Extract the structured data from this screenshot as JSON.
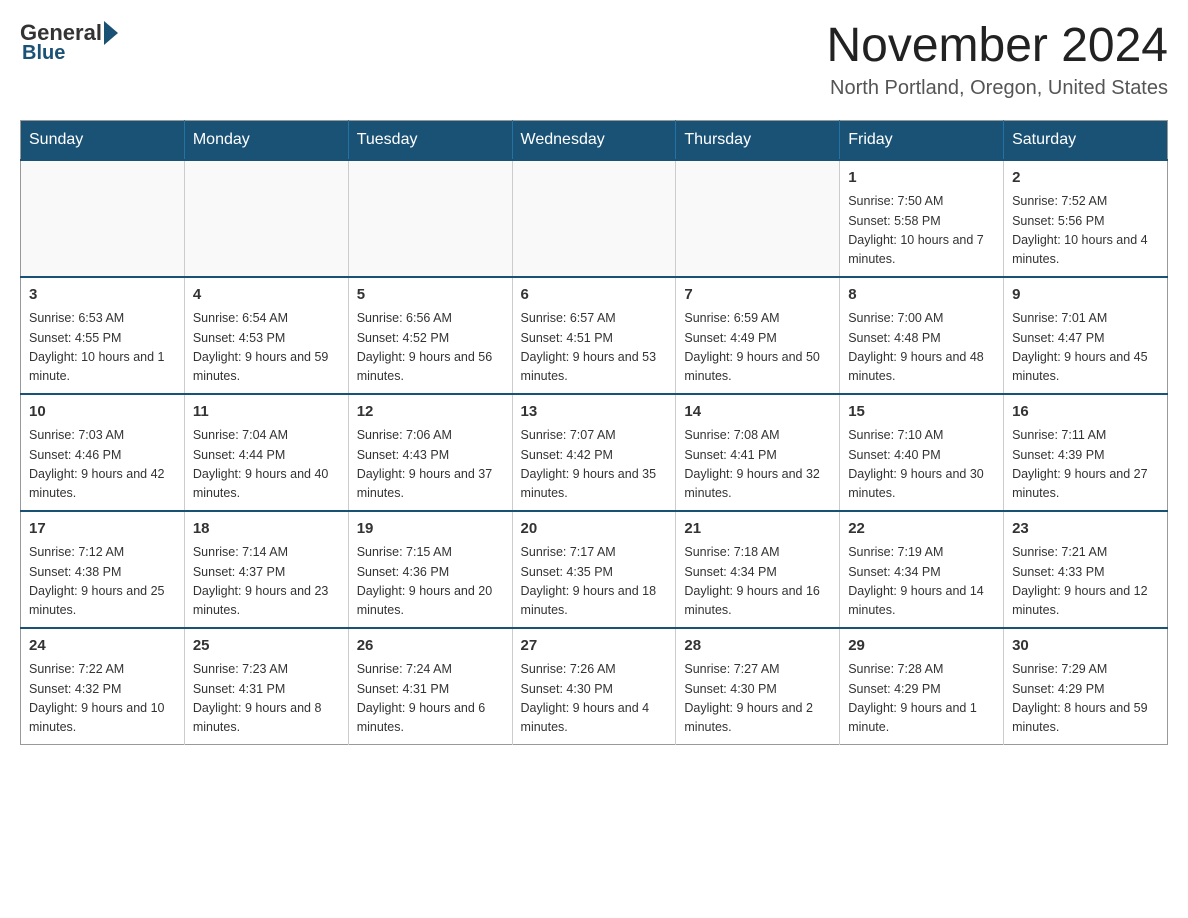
{
  "header": {
    "logo": {
      "general": "General",
      "blue": "Blue"
    },
    "title": "November 2024",
    "subtitle": "North Portland, Oregon, United States"
  },
  "weekdays": [
    "Sunday",
    "Monday",
    "Tuesday",
    "Wednesday",
    "Thursday",
    "Friday",
    "Saturday"
  ],
  "weeks": [
    [
      {
        "day": "",
        "sunrise": "",
        "sunset": "",
        "daylight": ""
      },
      {
        "day": "",
        "sunrise": "",
        "sunset": "",
        "daylight": ""
      },
      {
        "day": "",
        "sunrise": "",
        "sunset": "",
        "daylight": ""
      },
      {
        "day": "",
        "sunrise": "",
        "sunset": "",
        "daylight": ""
      },
      {
        "day": "",
        "sunrise": "",
        "sunset": "",
        "daylight": ""
      },
      {
        "day": "1",
        "sunrise": "Sunrise: 7:50 AM",
        "sunset": "Sunset: 5:58 PM",
        "daylight": "Daylight: 10 hours and 7 minutes."
      },
      {
        "day": "2",
        "sunrise": "Sunrise: 7:52 AM",
        "sunset": "Sunset: 5:56 PM",
        "daylight": "Daylight: 10 hours and 4 minutes."
      }
    ],
    [
      {
        "day": "3",
        "sunrise": "Sunrise: 6:53 AM",
        "sunset": "Sunset: 4:55 PM",
        "daylight": "Daylight: 10 hours and 1 minute."
      },
      {
        "day": "4",
        "sunrise": "Sunrise: 6:54 AM",
        "sunset": "Sunset: 4:53 PM",
        "daylight": "Daylight: 9 hours and 59 minutes."
      },
      {
        "day": "5",
        "sunrise": "Sunrise: 6:56 AM",
        "sunset": "Sunset: 4:52 PM",
        "daylight": "Daylight: 9 hours and 56 minutes."
      },
      {
        "day": "6",
        "sunrise": "Sunrise: 6:57 AM",
        "sunset": "Sunset: 4:51 PM",
        "daylight": "Daylight: 9 hours and 53 minutes."
      },
      {
        "day": "7",
        "sunrise": "Sunrise: 6:59 AM",
        "sunset": "Sunset: 4:49 PM",
        "daylight": "Daylight: 9 hours and 50 minutes."
      },
      {
        "day": "8",
        "sunrise": "Sunrise: 7:00 AM",
        "sunset": "Sunset: 4:48 PM",
        "daylight": "Daylight: 9 hours and 48 minutes."
      },
      {
        "day": "9",
        "sunrise": "Sunrise: 7:01 AM",
        "sunset": "Sunset: 4:47 PM",
        "daylight": "Daylight: 9 hours and 45 minutes."
      }
    ],
    [
      {
        "day": "10",
        "sunrise": "Sunrise: 7:03 AM",
        "sunset": "Sunset: 4:46 PM",
        "daylight": "Daylight: 9 hours and 42 minutes."
      },
      {
        "day": "11",
        "sunrise": "Sunrise: 7:04 AM",
        "sunset": "Sunset: 4:44 PM",
        "daylight": "Daylight: 9 hours and 40 minutes."
      },
      {
        "day": "12",
        "sunrise": "Sunrise: 7:06 AM",
        "sunset": "Sunset: 4:43 PM",
        "daylight": "Daylight: 9 hours and 37 minutes."
      },
      {
        "day": "13",
        "sunrise": "Sunrise: 7:07 AM",
        "sunset": "Sunset: 4:42 PM",
        "daylight": "Daylight: 9 hours and 35 minutes."
      },
      {
        "day": "14",
        "sunrise": "Sunrise: 7:08 AM",
        "sunset": "Sunset: 4:41 PM",
        "daylight": "Daylight: 9 hours and 32 minutes."
      },
      {
        "day": "15",
        "sunrise": "Sunrise: 7:10 AM",
        "sunset": "Sunset: 4:40 PM",
        "daylight": "Daylight: 9 hours and 30 minutes."
      },
      {
        "day": "16",
        "sunrise": "Sunrise: 7:11 AM",
        "sunset": "Sunset: 4:39 PM",
        "daylight": "Daylight: 9 hours and 27 minutes."
      }
    ],
    [
      {
        "day": "17",
        "sunrise": "Sunrise: 7:12 AM",
        "sunset": "Sunset: 4:38 PM",
        "daylight": "Daylight: 9 hours and 25 minutes."
      },
      {
        "day": "18",
        "sunrise": "Sunrise: 7:14 AM",
        "sunset": "Sunset: 4:37 PM",
        "daylight": "Daylight: 9 hours and 23 minutes."
      },
      {
        "day": "19",
        "sunrise": "Sunrise: 7:15 AM",
        "sunset": "Sunset: 4:36 PM",
        "daylight": "Daylight: 9 hours and 20 minutes."
      },
      {
        "day": "20",
        "sunrise": "Sunrise: 7:17 AM",
        "sunset": "Sunset: 4:35 PM",
        "daylight": "Daylight: 9 hours and 18 minutes."
      },
      {
        "day": "21",
        "sunrise": "Sunrise: 7:18 AM",
        "sunset": "Sunset: 4:34 PM",
        "daylight": "Daylight: 9 hours and 16 minutes."
      },
      {
        "day": "22",
        "sunrise": "Sunrise: 7:19 AM",
        "sunset": "Sunset: 4:34 PM",
        "daylight": "Daylight: 9 hours and 14 minutes."
      },
      {
        "day": "23",
        "sunrise": "Sunrise: 7:21 AM",
        "sunset": "Sunset: 4:33 PM",
        "daylight": "Daylight: 9 hours and 12 minutes."
      }
    ],
    [
      {
        "day": "24",
        "sunrise": "Sunrise: 7:22 AM",
        "sunset": "Sunset: 4:32 PM",
        "daylight": "Daylight: 9 hours and 10 minutes."
      },
      {
        "day": "25",
        "sunrise": "Sunrise: 7:23 AM",
        "sunset": "Sunset: 4:31 PM",
        "daylight": "Daylight: 9 hours and 8 minutes."
      },
      {
        "day": "26",
        "sunrise": "Sunrise: 7:24 AM",
        "sunset": "Sunset: 4:31 PM",
        "daylight": "Daylight: 9 hours and 6 minutes."
      },
      {
        "day": "27",
        "sunrise": "Sunrise: 7:26 AM",
        "sunset": "Sunset: 4:30 PM",
        "daylight": "Daylight: 9 hours and 4 minutes."
      },
      {
        "day": "28",
        "sunrise": "Sunrise: 7:27 AM",
        "sunset": "Sunset: 4:30 PM",
        "daylight": "Daylight: 9 hours and 2 minutes."
      },
      {
        "day": "29",
        "sunrise": "Sunrise: 7:28 AM",
        "sunset": "Sunset: 4:29 PM",
        "daylight": "Daylight: 9 hours and 1 minute."
      },
      {
        "day": "30",
        "sunrise": "Sunrise: 7:29 AM",
        "sunset": "Sunset: 4:29 PM",
        "daylight": "Daylight: 8 hours and 59 minutes."
      }
    ]
  ]
}
